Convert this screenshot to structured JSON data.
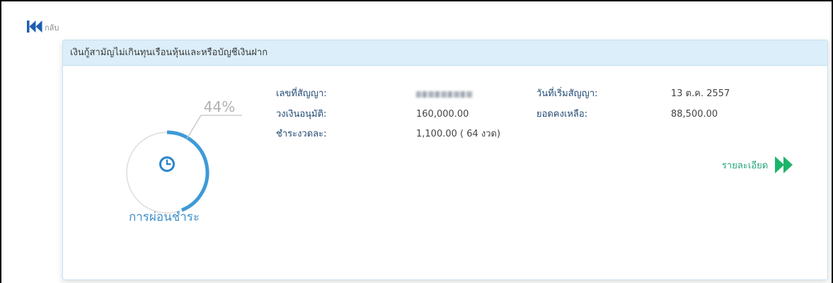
{
  "nav": {
    "back_label": "กลับ",
    "back_icon": "double-chevron-left-icon"
  },
  "card": {
    "title": "เงินกู้สามัญไม่เกินทุนเรือนหุ้นและหรือบัญชีเงินฝาก",
    "progress": {
      "value_percent": 44,
      "label": "44%",
      "caption": "การผ่อนชำระ",
      "icon": "clock-icon"
    },
    "fields": {
      "contract_no_label": "เลขที่สัญญา:",
      "approved_limit_label": "วงเงินอนุมัติ:",
      "approved_limit_value": "160,000.00",
      "installment_label": "ชำระงวดละ:",
      "installment_value": "1,100.00 ( 64 งวด)",
      "start_date_label": "วันที่เริ่มสัญญา:",
      "start_date_value": "13 ต.ค. 2557",
      "balance_label": "ยอดคงเหลือ:",
      "balance_value": "88,500.00"
    },
    "details_link": {
      "label": "รายละเอียด",
      "icon": "double-chevron-right-icon"
    }
  },
  "colors": {
    "back_icon": "#1d5fae",
    "progress_arc": "#3d9ad8",
    "progress_track": "#dddddd",
    "clock_icon": "#2a86cc",
    "details_icon": "#1db46b",
    "header_bg": "#dbeef9"
  }
}
